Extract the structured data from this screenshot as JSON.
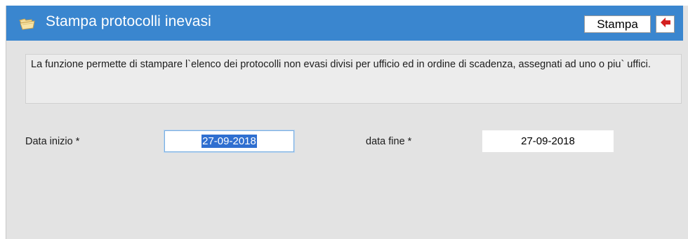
{
  "header": {
    "title": "Stampa protocolli inevasi",
    "icon": "folder-open-icon",
    "print_label": "Stampa",
    "exit_icon": "exit-arrow-icon"
  },
  "info": {
    "text": "La funzione permette di stampare l`elenco dei protocolli non evasi divisi per ufficio ed in ordine di scadenza, assegnati ad uno o piu` uffici."
  },
  "form": {
    "start_label": "Data inizio *",
    "start_value": "27-09-2018",
    "end_label": "data fine *",
    "end_value": "27-09-2018"
  },
  "colors": {
    "titlebar": "#3a86cf",
    "background": "#e3e3e3",
    "selection": "#2f6fd0",
    "exit_arrow": "#d42020"
  }
}
